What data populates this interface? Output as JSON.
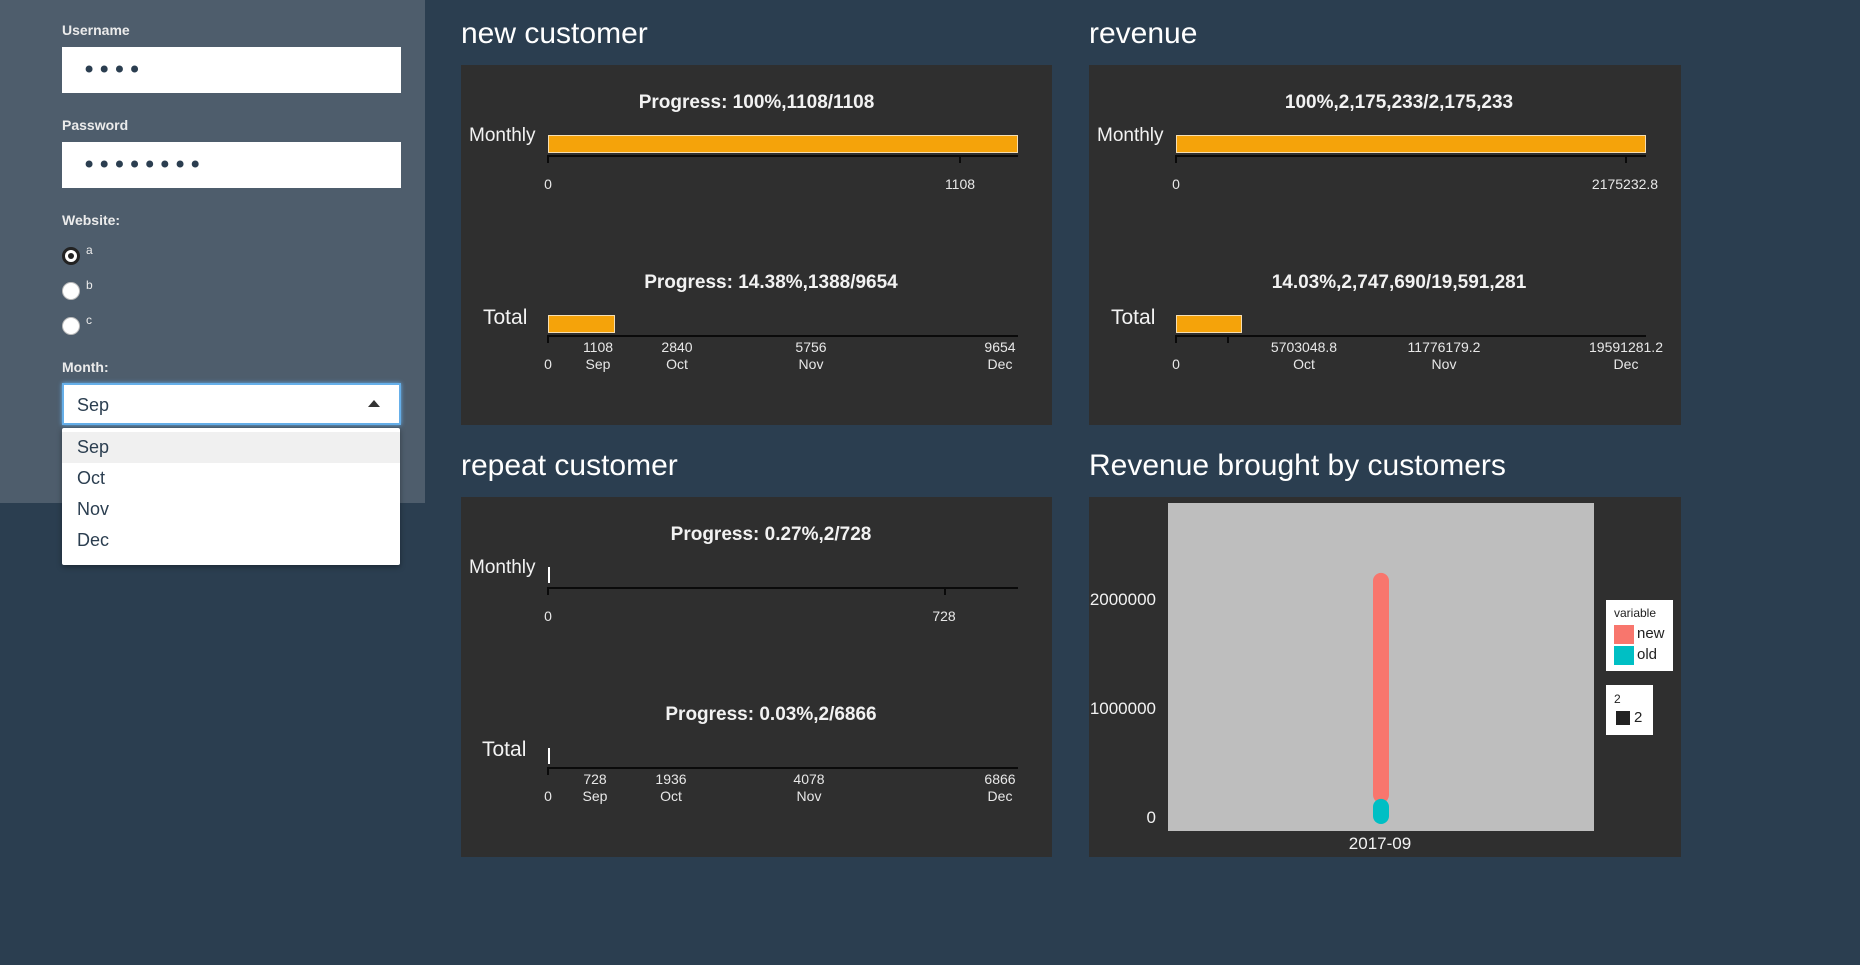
{
  "sidebar": {
    "username_label": "Username",
    "username_value": "••••",
    "password_label": "Password",
    "password_value": "••••••••",
    "website_label": "Website:",
    "website_options": [
      "a",
      "b",
      "c"
    ],
    "website_selected": "a",
    "month_label": "Month:",
    "month_value": "Sep",
    "month_options": [
      "Sep",
      "Oct",
      "Nov",
      "Dec"
    ]
  },
  "panels": {
    "new_customer": {
      "title": "new customer",
      "monthly": {
        "title": "Progress: 100%,1108/1108",
        "label": "Monthly",
        "fraction": 1.0,
        "ticks": [
          "0",
          "1108"
        ]
      },
      "total": {
        "title": "Progress: 14.38%,1388/9654",
        "label": "Total",
        "fraction": 0.1438,
        "ticks": [
          {
            "value": "0",
            "month": ""
          },
          {
            "value": "1108",
            "month": "Sep"
          },
          {
            "value": "2840",
            "month": "Oct"
          },
          {
            "value": "5756",
            "month": "Nov"
          },
          {
            "value": "9654",
            "month": "Dec"
          }
        ]
      }
    },
    "revenue": {
      "title": "revenue",
      "monthly": {
        "title": "100%,2,175,233/2,175,233",
        "label": "Monthly",
        "fraction": 1.0,
        "ticks": [
          "0",
          "2175232.8"
        ]
      },
      "total": {
        "title": "14.03%,2,747,690/19,591,281",
        "label": "Total",
        "fraction": 0.1403,
        "ticks": [
          {
            "value": "0",
            "month": ""
          },
          {
            "value": "5703048.8",
            "month": "Oct"
          },
          {
            "value": "11776179.2",
            "month": "Nov"
          },
          {
            "value": "19591281.2",
            "month": "Dec"
          }
        ]
      }
    },
    "repeat_customer": {
      "title": "repeat customer",
      "monthly": {
        "title": "Progress: 0.27%,2/728",
        "label": "Monthly",
        "fraction": 0.0027,
        "ticks": [
          "0",
          "728"
        ]
      },
      "total": {
        "title": "Progress: 0.03%,2/6866",
        "label": "Total",
        "fraction": 0.0003,
        "ticks": [
          {
            "value": "0",
            "month": ""
          },
          {
            "value": "728",
            "month": "Sep"
          },
          {
            "value": "1936",
            "month": "Oct"
          },
          {
            "value": "4078",
            "month": "Nov"
          },
          {
            "value": "6866",
            "month": "Dec"
          }
        ]
      }
    },
    "revenue_by_customers": {
      "title": "Revenue brought by customers"
    }
  },
  "chart_data": {
    "type": "bar",
    "categories": [
      "2017-09"
    ],
    "series": [
      {
        "name": "new",
        "values": [
          2000000
        ]
      },
      {
        "name": "old",
        "values": [
          175000
        ]
      }
    ],
    "ylim": [
      0,
      2900000
    ],
    "yticks": [
      "0",
      "1000000",
      "2000000"
    ],
    "legend": {
      "title": "variable",
      "entries": [
        "new",
        "old"
      ],
      "size_title": "2",
      "size_entry": "2",
      "placement": "right"
    },
    "colors": {
      "new": "#f8766d",
      "old": "#00bfc4"
    }
  },
  "colors": {
    "accent_bar": "#f5a30a",
    "background": "#2b3e50",
    "sidebar": "#4e5d6c",
    "panel": "#2f2f2f"
  }
}
